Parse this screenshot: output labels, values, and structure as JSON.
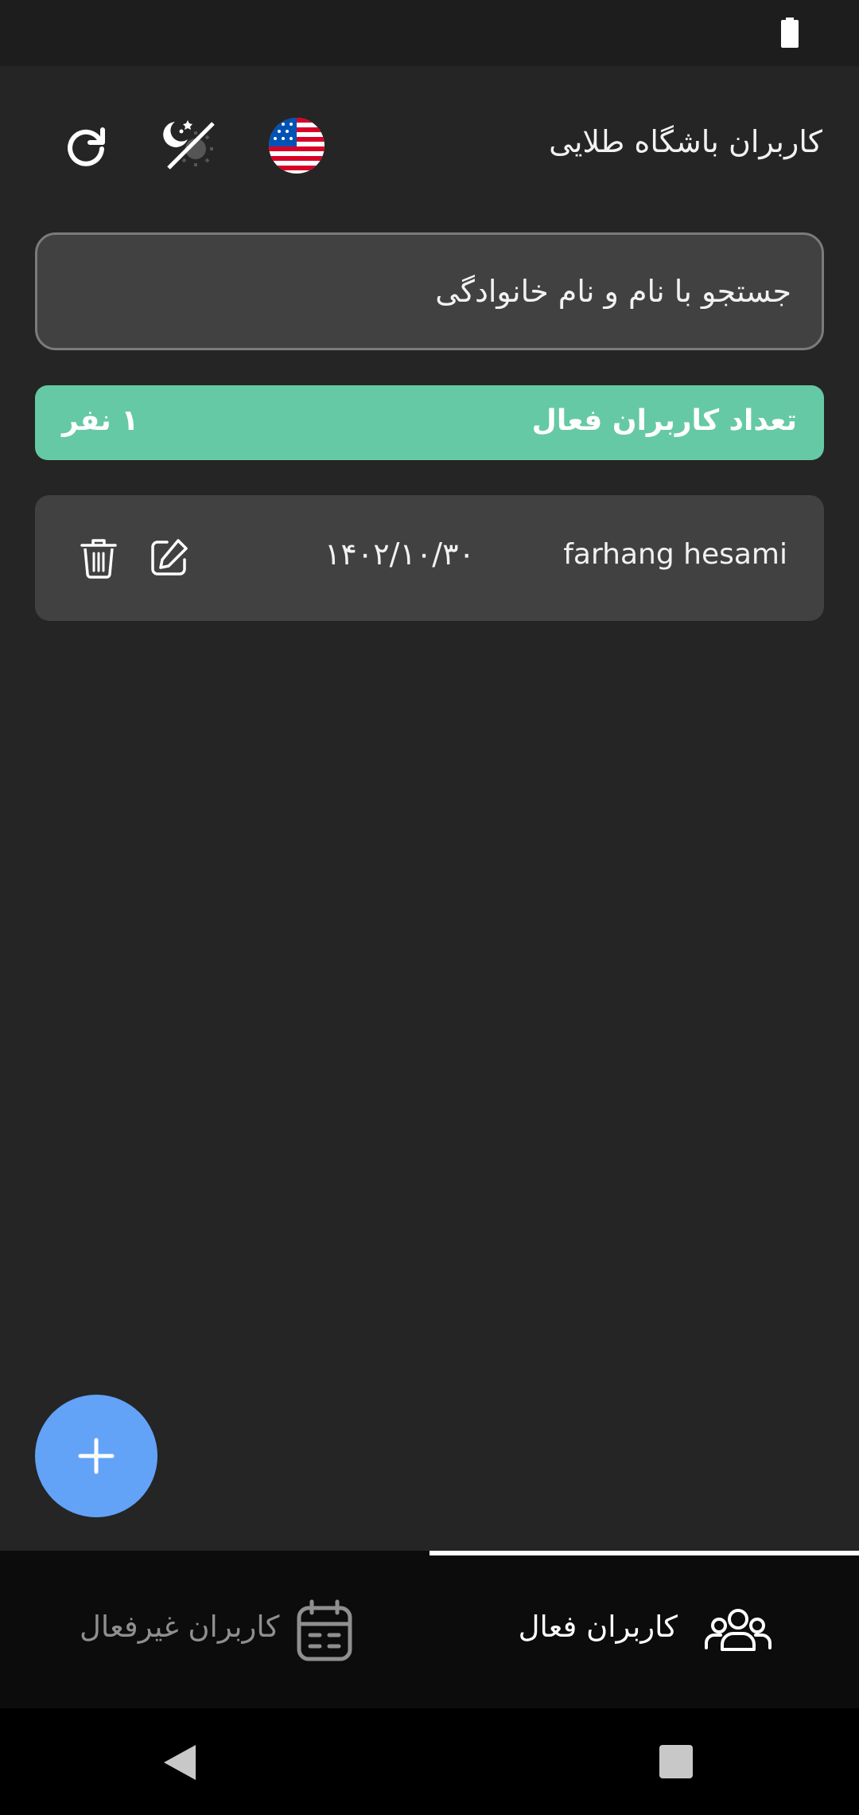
{
  "header": {
    "title": "کاربران باشگاه طلایی",
    "refresh_icon": "refresh-icon",
    "theme_icon": "theme-toggle-icon",
    "language_icon": "us-flag-icon"
  },
  "search": {
    "placeholder": "جستجو با نام و نام خانوادگی",
    "value": ""
  },
  "summary": {
    "label": "تعداد کاربران فعال",
    "count": "۱ نفر",
    "color": "#66c9a5"
  },
  "users": [
    {
      "name": "farhang hesami",
      "date": "۱۴۰۲/۱۰/۳۰"
    }
  ],
  "fab": {
    "icon": "plus-icon",
    "color": "#62a3f8"
  },
  "tabs": [
    {
      "label": "کاربران فعال",
      "icon": "users-group-icon",
      "active": true
    },
    {
      "label": "کاربران غیرفعال",
      "icon": "calendar-icon",
      "active": false
    }
  ],
  "colors": {
    "background": "#252525",
    "card": "#414141",
    "nav_background": "#0c0c0c"
  }
}
